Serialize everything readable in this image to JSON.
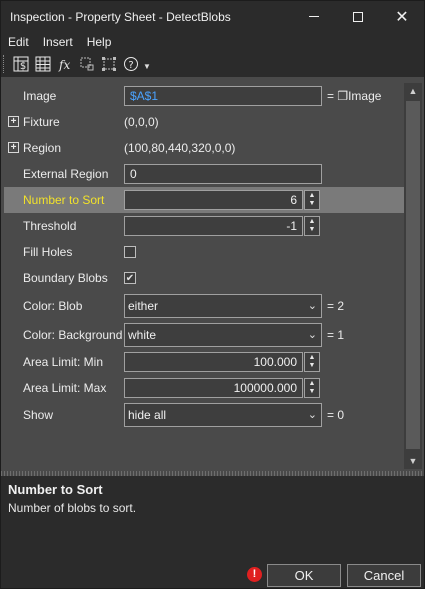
{
  "window": {
    "title": "Inspection - Property Sheet - DetectBlobs"
  },
  "menu": [
    "Edit",
    "Insert",
    "Help"
  ],
  "toolbar": [
    "spreadsheet-dollar-icon",
    "table-icon",
    "function-icon",
    "select-region-icon",
    "fit-region-icon",
    "help-icon",
    "toolbar-options-icon"
  ],
  "properties": {
    "image": {
      "label": "Image",
      "value": "$A$1",
      "suffix": "= ❐Image"
    },
    "fixture": {
      "label": "Fixture",
      "value": "(0,0,0)",
      "expander": "+"
    },
    "region": {
      "label": "Region",
      "value": "(100,80,440,320,0,0)",
      "expander": "+"
    },
    "external_region": {
      "label": "External Region",
      "value": "0"
    },
    "number_to_sort": {
      "label": "Number to Sort",
      "value": "6"
    },
    "threshold": {
      "label": "Threshold",
      "value": "-1"
    },
    "fill_holes": {
      "label": "Fill Holes",
      "checked": false
    },
    "boundary_blobs": {
      "label": "Boundary Blobs",
      "checked": true
    },
    "color_blob": {
      "label": "Color: Blob",
      "value": "either",
      "suffix": "= 2"
    },
    "color_background": {
      "label": "Color: Background",
      "value": "white",
      "suffix": "= 1"
    },
    "area_min": {
      "label": "Area Limit: Min",
      "value": "100.000"
    },
    "area_max": {
      "label": "Area Limit: Max",
      "value": "100000.000"
    },
    "show": {
      "label": "Show",
      "value": "hide all",
      "suffix": "= 0"
    }
  },
  "description": {
    "title": "Number to Sort",
    "text": "Number of blobs to sort."
  },
  "footer": {
    "warning": "!",
    "ok": "OK",
    "cancel": "Cancel"
  },
  "colors": {
    "selected_label": "#f2e22a",
    "link": "#4aa3ff",
    "warning": "#e02020"
  }
}
